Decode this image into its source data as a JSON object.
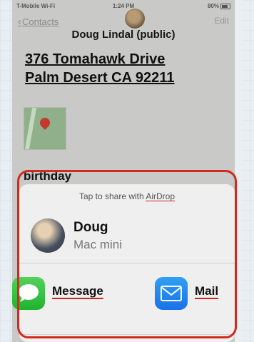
{
  "status_bar": {
    "carrier": "T-Mobile Wi-Fi",
    "time": "1:24 PM",
    "battery": "80%"
  },
  "nav": {
    "back_label": "Contacts",
    "edit_label": "Edit"
  },
  "contact": {
    "name": "Doug Lindal (public)",
    "address_line1": "376 Tomahawk Drive",
    "address_line2": "Palm Desert CA 92211",
    "birthday_label": "birthday"
  },
  "share_sheet": {
    "airdrop_prefix": "Tap to share with ",
    "airdrop_word": "AirDrop",
    "device": {
      "name": "Doug",
      "type": "Mac mini"
    },
    "apps": [
      {
        "label": "Message",
        "icon": "message-bubble-icon"
      },
      {
        "label": "Mail",
        "icon": "envelope-icon"
      }
    ]
  },
  "colors": {
    "highlight": "#d22a1c",
    "message_green": "#34c759",
    "mail_blue": "#1a7ee8"
  }
}
